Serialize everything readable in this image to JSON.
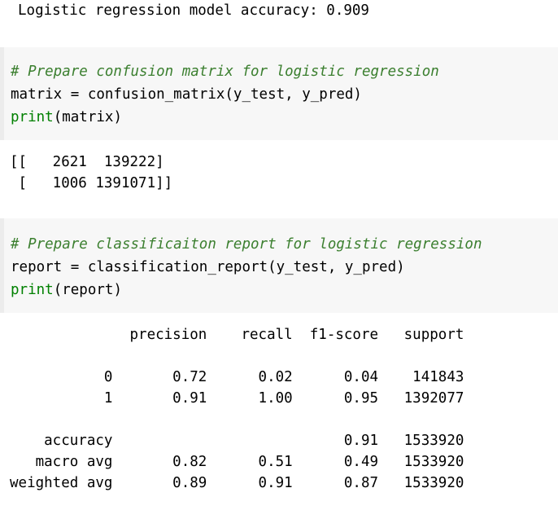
{
  "output_accuracy": {
    "text": "Logistic regression model accuracy: 0.909"
  },
  "cell_matrix": {
    "comment": "# Prepare confusion matrix for logistic regression",
    "line2_var": "matrix = confusion_matrix(y_test, y_pred)",
    "line3_fn": "print",
    "line3_args": "(matrix)"
  },
  "output_matrix": {
    "lines": [
      "[[   2621  139222]",
      " [   1006 1391071]]"
    ]
  },
  "cell_report": {
    "comment": "# Prepare classificaiton report for logistic regression",
    "line2_var": "report = classification_report(y_test, y_pred)",
    "line3_fn": "print",
    "line3_args": "(report)"
  },
  "output_report": {
    "header": "              precision    recall  f1-score   support",
    "rows": [
      "           0       0.72      0.02      0.04    141843",
      "           1       0.91      1.00      0.95   1392077",
      "",
      "    accuracy                           0.91   1533920",
      "   macro avg       0.82      0.51      0.49   1533920",
      "weighted avg       0.89      0.91      0.87   1533920"
    ]
  }
}
